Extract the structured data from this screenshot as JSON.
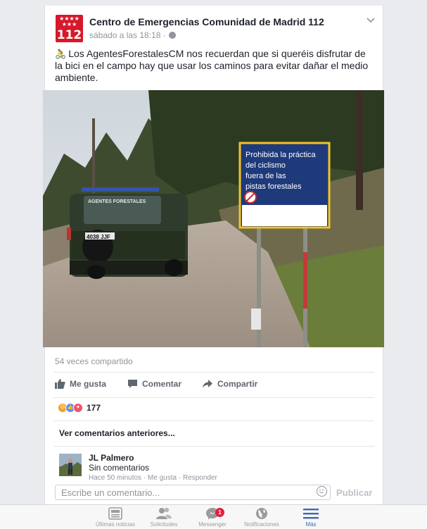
{
  "post": {
    "page_name": "Centro de Emergencias Comunidad de Madrid 112",
    "timestamp": "sábado a las 18:18 ·",
    "text": "Los AgentesForestalesCM nos recuerdan que si queréis disfrutar de la bici en el campo hay que usar los caminos para evitar dañar el medio ambiente.",
    "avatar_text": "112",
    "photo": {
      "vehicle_label": "AGENTES FORESTALES",
      "plate": "4038 JJF",
      "sign_text": [
        "Prohibida la práctica",
        "del ciclismo",
        "fuera de las",
        "pistas forestales"
      ]
    }
  },
  "shares": "54 veces compartido",
  "actions": {
    "like": "Me gusta",
    "comment": "Comentar",
    "share": "Compartir"
  },
  "reactions": {
    "count": "177"
  },
  "comments": {
    "previous_link": "Ver comentarios anteriores...",
    "items": [
      {
        "name": "JL Palmero",
        "text": "Sin comentarios",
        "meta": "Hace 50 minutos · Me gusta · Responder"
      }
    ]
  },
  "composer": {
    "placeholder": "Escribe un comentario...",
    "publish": "Publicar"
  },
  "nav": [
    {
      "label": "Últimas noticias",
      "icon": "news-feed-icon"
    },
    {
      "label": "Solicitudes",
      "icon": "friends-icon"
    },
    {
      "label": "Messenger",
      "icon": "messenger-icon",
      "badge": "1"
    },
    {
      "label": "Notificaciones",
      "icon": "globe-icon"
    },
    {
      "label": "Más",
      "icon": "menu-icon",
      "active": true
    }
  ],
  "colors": {
    "accent": "#4267b2",
    "brand_red": "#d7182a",
    "sign_blue": "#1f3a7a",
    "badge_red": "#e41e3f"
  }
}
